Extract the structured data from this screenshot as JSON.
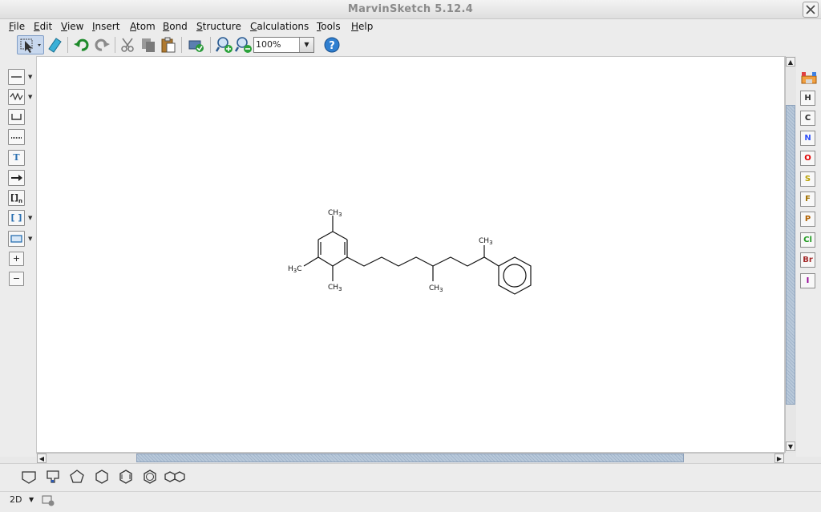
{
  "window": {
    "title": "MarvinSketch 5.12.4"
  },
  "menu": [
    "File",
    "Edit",
    "View",
    "Insert",
    "Atom",
    "Bond",
    "Structure",
    "Calculations",
    "Tools",
    "Help"
  ],
  "toolbar": {
    "icons": [
      "select-icon",
      "eraser-icon",
      "undo-icon",
      "redo-icon",
      "cut-icon",
      "copy-icon",
      "paste-icon",
      "clean-icon",
      "zoom-in-icon",
      "zoom-out-icon",
      "help-icon"
    ],
    "zoom_value": "100%"
  },
  "left_tools": {
    "text_tool_label": "T",
    "bracket_label": "[]",
    "bracket_sub": "n",
    "sgroup_label": "[ ]",
    "charge_plus": "+",
    "charge_minus": "−"
  },
  "atoms": [
    "H",
    "C",
    "N",
    "O",
    "S",
    "F",
    "P",
    "Cl",
    "Br",
    "I"
  ],
  "atom_colors": {
    "H": "#333333",
    "C": "#222222",
    "N": "#3050f8",
    "O": "#e00000",
    "S": "#b8a000",
    "F": "#a07000",
    "P": "#b06000",
    "Cl": "#1f9a1f",
    "Br": "#a52a2a",
    "I": "#940094"
  },
  "molecule": {
    "labels": {
      "ch3_top": "CH",
      "ch3_top_sub": "3",
      "h3c_left": "H",
      "h3c_left_sub": "3",
      "h3c_left_c": "C",
      "ch3_bottom": "CH",
      "ch3_bottom_sub": "3",
      "ch3_chain": "CH",
      "ch3_chain_sub": "3",
      "ch3_right": "CH",
      "ch3_right_sub": "3"
    }
  },
  "templates": [
    "polygon-cursor-icon",
    "tpl-square-icon",
    "tpl-pentagon-icon",
    "tpl-hexagon-icon",
    "tpl-cyclohexadiene-icon",
    "tpl-benzene-icon",
    "tpl-naphthalene-icon"
  ],
  "status": {
    "dimension": "2D"
  }
}
